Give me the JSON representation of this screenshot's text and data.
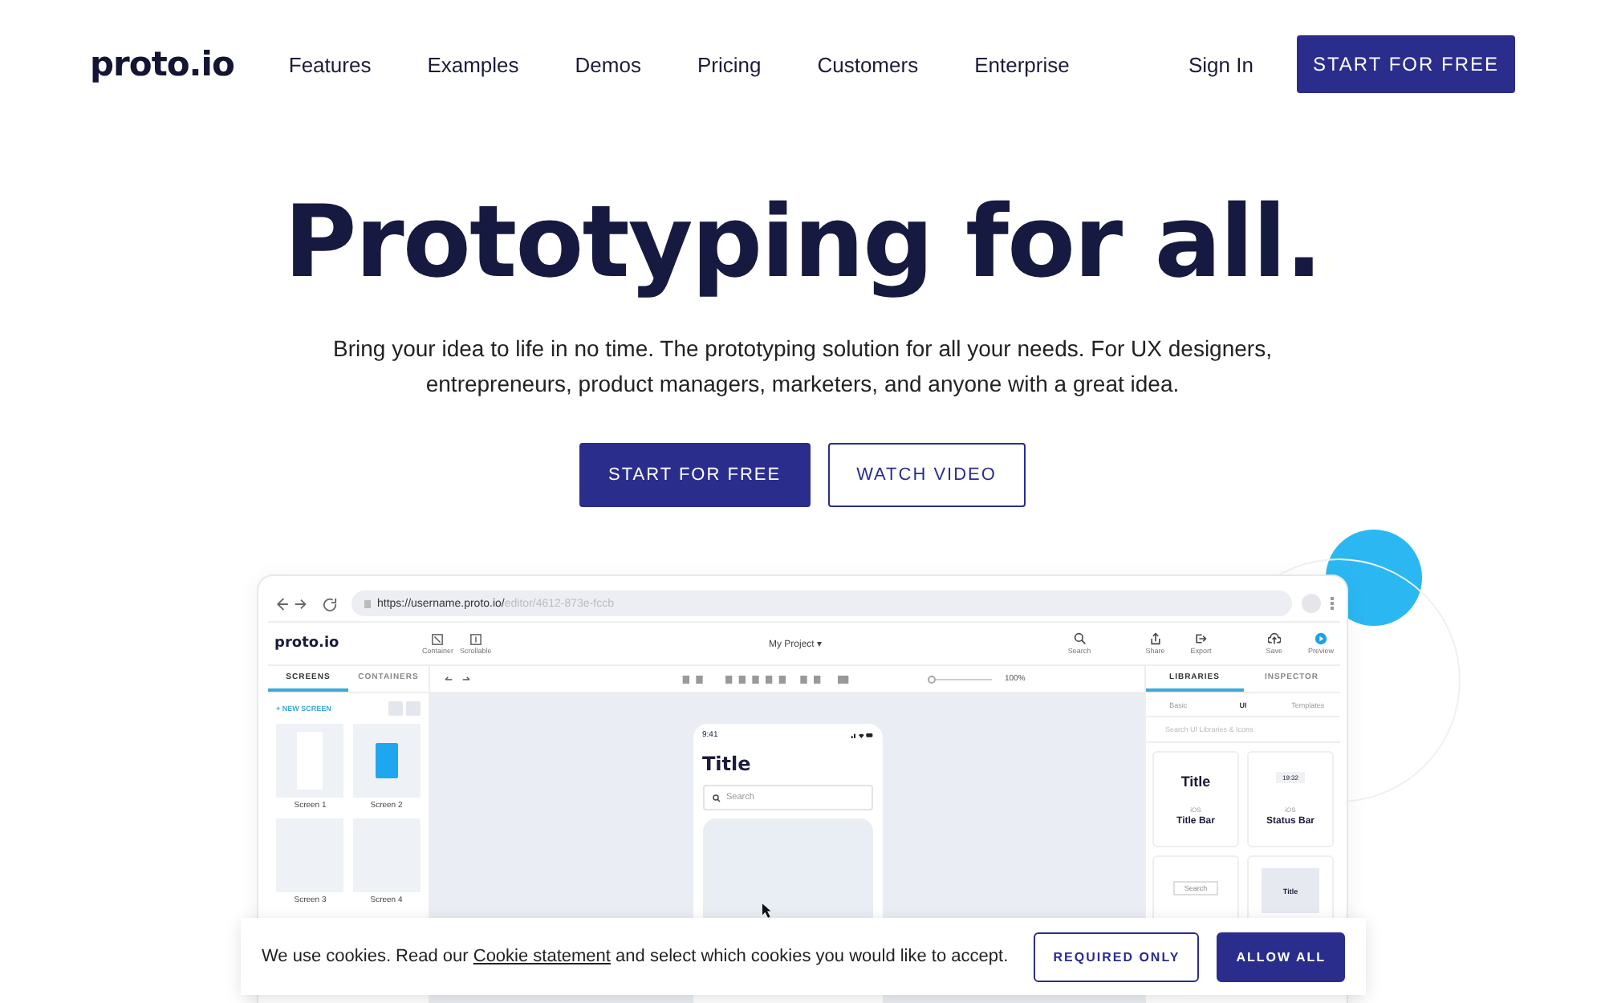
{
  "nav": {
    "logo": "proto.io",
    "links": [
      "Features",
      "Examples",
      "Demos",
      "Pricing",
      "Customers",
      "Enterprise"
    ],
    "sign_in": "Sign In",
    "cta": "START FOR FREE"
  },
  "hero": {
    "title": "Prototyping for all.",
    "subtitle": "Bring your idea to life in no time. The prototyping solution for all your needs. For UX designers, entrepreneurs, product managers, marketers, and anyone with a great idea.",
    "primary": "START FOR FREE",
    "secondary": "WATCH VIDEO"
  },
  "mockup": {
    "url_host": "https://username.proto.io/",
    "url_path": "editor/4612-873e-fccb",
    "app_logo": "proto.io",
    "tools": [
      {
        "label": "Container",
        "kind": "container"
      },
      {
        "label": "Scrollable",
        "kind": "scroll"
      }
    ],
    "project": "My Project ▾",
    "actions": [
      {
        "label": "Search",
        "kind": "search"
      },
      {
        "label": "Share",
        "kind": "share"
      },
      {
        "label": "Export",
        "kind": "export"
      },
      {
        "label": "Save",
        "kind": "save"
      },
      {
        "label": "Preview",
        "kind": "preview"
      }
    ],
    "zoom": "100%",
    "zoom_slider": {
      "level": 0.05
    },
    "left_tabs": [
      {
        "label": "SCREENS",
        "selected": true
      },
      {
        "label": "CONTAINERS",
        "selected": false
      }
    ],
    "new_screen": "+ NEW SCREEN",
    "screens": [
      {
        "label": "Screen 1",
        "kind": "blank"
      },
      {
        "label": "Screen 2",
        "kind": "app"
      },
      {
        "label": "Screen 3",
        "kind": "empty"
      },
      {
        "label": "Screen 4",
        "kind": "empty"
      }
    ],
    "phone": {
      "time": "9:41",
      "title": "Title",
      "search_placeholder": "Search"
    },
    "right_tabs": [
      {
        "label": "LIBRARIES",
        "selected": true
      },
      {
        "label": "INSPECTOR",
        "selected": false
      }
    ],
    "lib_tabs": [
      {
        "label": "Basic",
        "selected": false
      },
      {
        "label": "UI",
        "selected": true
      },
      {
        "label": "Templates",
        "selected": false
      }
    ],
    "lib_search": "Search UI Libraries & Icons",
    "components": [
      {
        "kind": "title",
        "preview": "Title",
        "platform": "iOS",
        "name": "Title Bar"
      },
      {
        "kind": "status",
        "preview": "19:32",
        "platform": "iOS",
        "name": "Status Bar"
      },
      {
        "kind": "search",
        "preview": "Search"
      },
      {
        "kind": "template",
        "preview": "Title"
      }
    ]
  },
  "cookie": {
    "before": "We use cookies. Read our ",
    "link": "Cookie statement",
    "after": " and select which cookies you would like to accept.",
    "buttons": [
      {
        "label": "REQUIRED ONLY",
        "kind": "outline"
      },
      {
        "label": "ALLOW ALL",
        "kind": "solid"
      }
    ]
  }
}
